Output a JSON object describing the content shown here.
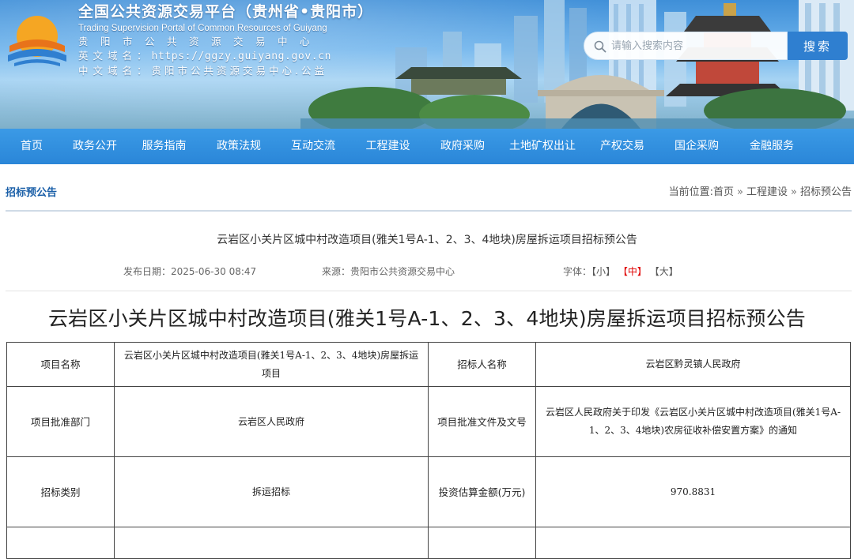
{
  "header": {
    "title_cn": "全国公共资源交易平台（贵州省•贵阳市）",
    "title_en": "Trading Supervision Portal of Common Resources of Guiyang",
    "center_name": "贵阳市公共资源交易中心",
    "en_domain_label": "英文域名：",
    "en_domain_value": "https://ggzy.guiyang.gov.cn",
    "cn_domain_label": "中文域名：",
    "cn_domain_value": "贵阳市公共资源交易中心.公益"
  },
  "search": {
    "placeholder": "请输入搜索内容",
    "button_label": "搜索"
  },
  "nav": {
    "items": [
      {
        "label": "首页"
      },
      {
        "label": "政务公开"
      },
      {
        "label": "服务指南"
      },
      {
        "label": "政策法规"
      },
      {
        "label": "互动交流"
      },
      {
        "label": "工程建设"
      },
      {
        "label": "政府采购"
      },
      {
        "label": "土地矿权出让"
      },
      {
        "label": "产权交易"
      },
      {
        "label": "国企采购"
      },
      {
        "label": "金融服务"
      }
    ]
  },
  "section": {
    "title": "招标预公告"
  },
  "breadcrumb": {
    "prefix": "当前位置:",
    "items": [
      "首页",
      "工程建设",
      "招标预公告"
    ],
    "separator": "»"
  },
  "article": {
    "title": "云岩区小关片区城中村改造项目(雅关1号A-1、2、3、4地块)房屋拆运项目招标预公告",
    "date_label": "发布日期：",
    "date_value": "2025-06-30 08:47",
    "source_label": "来源：",
    "source_value": "贵阳市公共资源交易中心",
    "fontsize_label": "字体：",
    "fontsize_small": "【小】",
    "fontsize_medium": "【中】",
    "fontsize_large": "【大】",
    "doc_title": "云岩区小关片区城中村改造项目(雅关1号A-1、2、3、4地块)房屋拆运项目招标预公告"
  },
  "table": {
    "rows": [
      {
        "k1": "项目名称",
        "v1": "云岩区小关片区城中村改造项目(雅关1号A-1、2、3、4地块)房屋拆运项目",
        "k2": "招标人名称",
        "v2": "云岩区黔灵镇人民政府"
      },
      {
        "k1": "项目批准部门",
        "v1": "云岩区人民政府",
        "k2": "项目批准文件及文号",
        "v2": "云岩区人民政府关于印发《云岩区小关片区城中村改造项目(雅关1号A-1、2、3、4地块)农房征收补偿安置方案》的通知"
      },
      {
        "k1": "招标类别",
        "v1": "拆运招标",
        "k2": "投资估算金额(万元)",
        "v2": "970.8831"
      }
    ]
  },
  "colors": {
    "nav_bg": "#2a86d8",
    "search_button": "#2f7fd0",
    "section_title": "#1a5fa8",
    "active_font_size": "#e00000"
  }
}
